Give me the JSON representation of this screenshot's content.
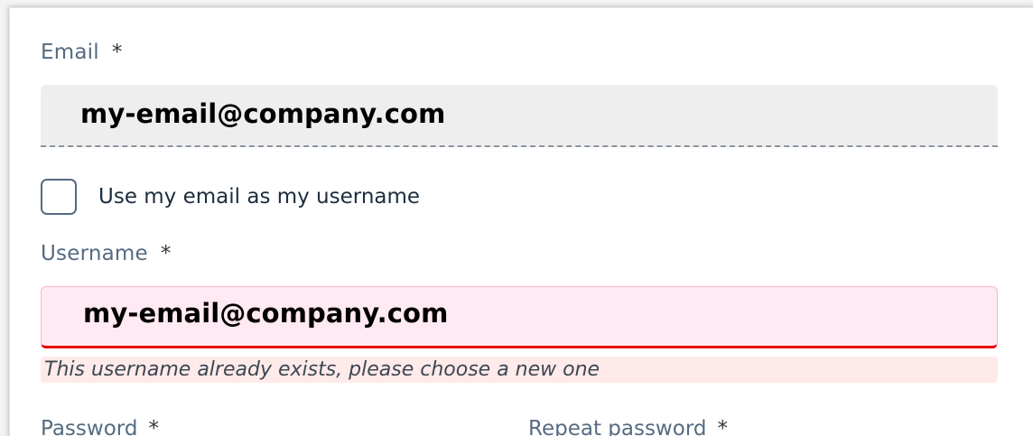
{
  "form": {
    "email": {
      "label": "Email",
      "required_mark": "*",
      "value": "my-email@company.com"
    },
    "use_email_checkbox": {
      "label": "Use my email as my username",
      "checked": false
    },
    "username": {
      "label": "Username",
      "required_mark": "*",
      "value": "my-email@company.com",
      "error": "This username already exists, please choose a new one"
    },
    "password": {
      "label": "Password",
      "required_mark": "*"
    },
    "repeat_password": {
      "label": "Repeat password",
      "required_mark": "*"
    }
  },
  "colors": {
    "label_text": "#556b82",
    "readonly_field_bg": "#eeeeef",
    "error_field_bg": "#ffe9f2",
    "error_border": "#e60000",
    "error_message_bg": "#ffeaea"
  }
}
